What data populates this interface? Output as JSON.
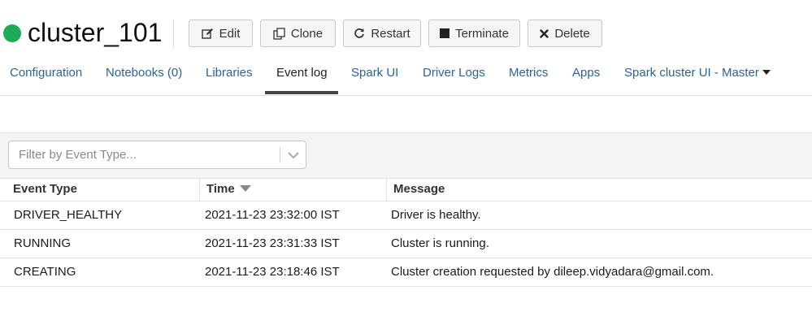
{
  "cluster": {
    "name": "cluster_101",
    "status_color": "#1faa59"
  },
  "actions": {
    "edit": "Edit",
    "clone": "Clone",
    "restart": "Restart",
    "terminate": "Terminate",
    "delete": "Delete"
  },
  "tabs": [
    {
      "label": "Configuration"
    },
    {
      "label": "Notebooks (0)"
    },
    {
      "label": "Libraries"
    },
    {
      "label": "Event log",
      "active": true
    },
    {
      "label": "Spark UI"
    },
    {
      "label": "Driver Logs"
    },
    {
      "label": "Metrics"
    },
    {
      "label": "Apps"
    },
    {
      "label": "Spark cluster UI - Master"
    }
  ],
  "filter": {
    "placeholder": "Filter by Event Type..."
  },
  "table": {
    "columns": [
      "Event Type",
      "Time",
      "Message"
    ],
    "sorted_column": "Time",
    "sort_direction": "descending",
    "rows": [
      {
        "type": "DRIVER_HEALTHY",
        "time": "2021-11-23 23:32:00 IST",
        "message": "Driver is healthy."
      },
      {
        "type": "RUNNING",
        "time": "2021-11-23 23:31:33 IST",
        "message": "Cluster is running."
      },
      {
        "type": "CREATING",
        "time": "2021-11-23 23:18:46 IST",
        "message": "Cluster creation requested by dileep.vidyadara@gmail.com."
      }
    ]
  },
  "colors": {
    "link": "#2a6496",
    "active_tab_underline": "#444444",
    "filter_bar_bg": "#f4f4f4"
  }
}
